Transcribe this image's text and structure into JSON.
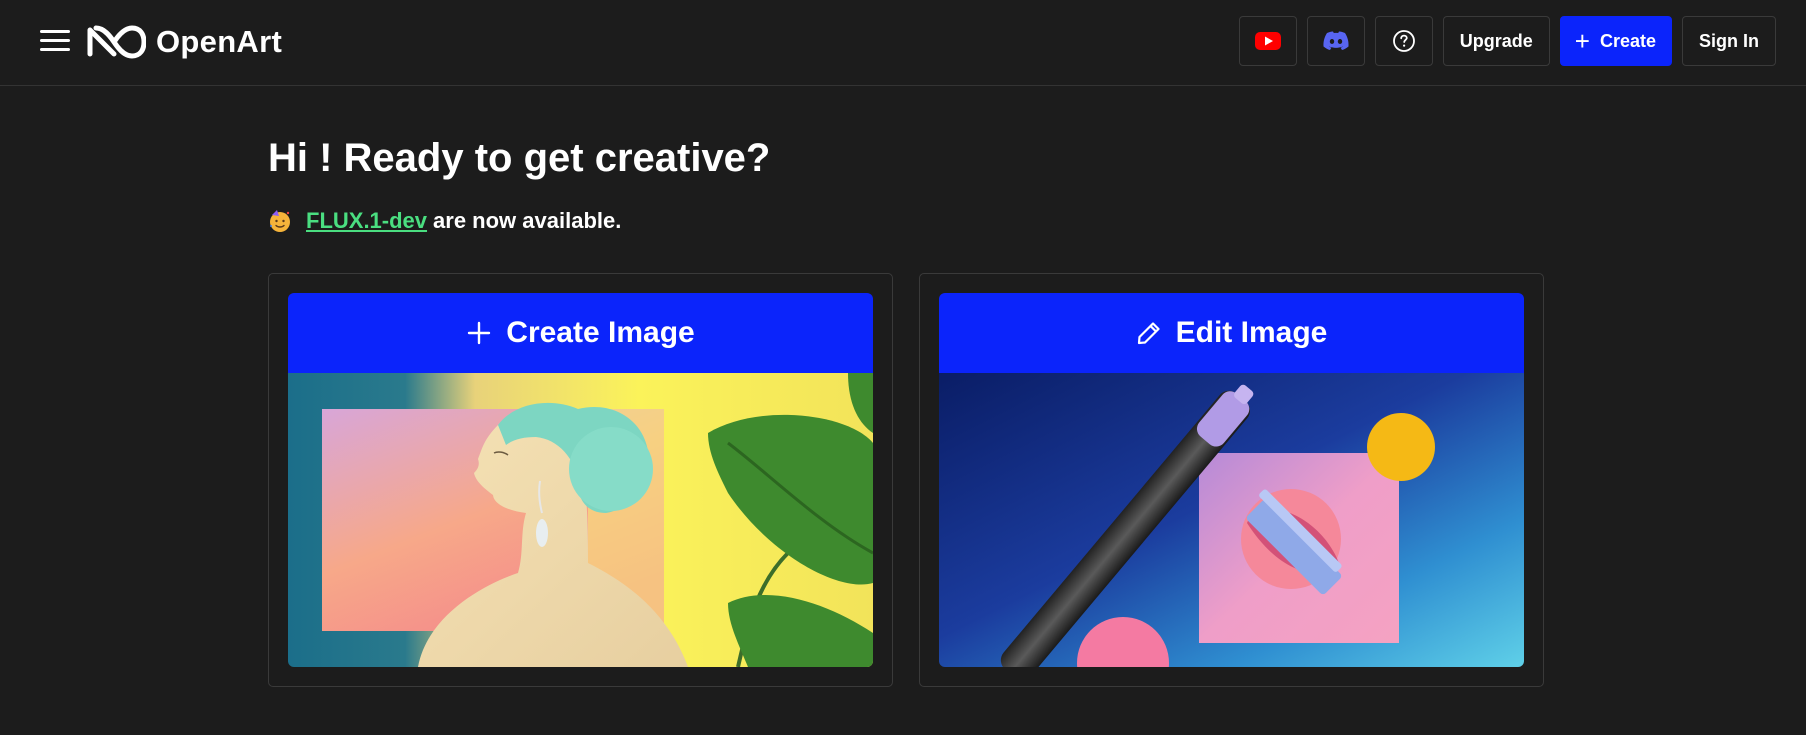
{
  "app": {
    "brand": "OpenArt"
  },
  "nav": {
    "youtube_icon": "youtube-icon",
    "discord_icon": "discord-icon",
    "help_icon": "help-circle-icon",
    "upgrade_label": "Upgrade",
    "create_label": "Create",
    "signin_label": "Sign In"
  },
  "main": {
    "greeting": "Hi ! Ready to get creative?",
    "notice": {
      "emoji_icon": "party-face-icon",
      "link_text": "FLUX.1-dev",
      "suffix": "are now available."
    },
    "cards": [
      {
        "label": "Create Image",
        "icon": "plus-icon"
      },
      {
        "label": "Edit Image",
        "icon": "pencil-icon"
      }
    ]
  },
  "colors": {
    "background": "#1c1c1c",
    "accent": "#0b24fb",
    "link": "#4ade80"
  }
}
